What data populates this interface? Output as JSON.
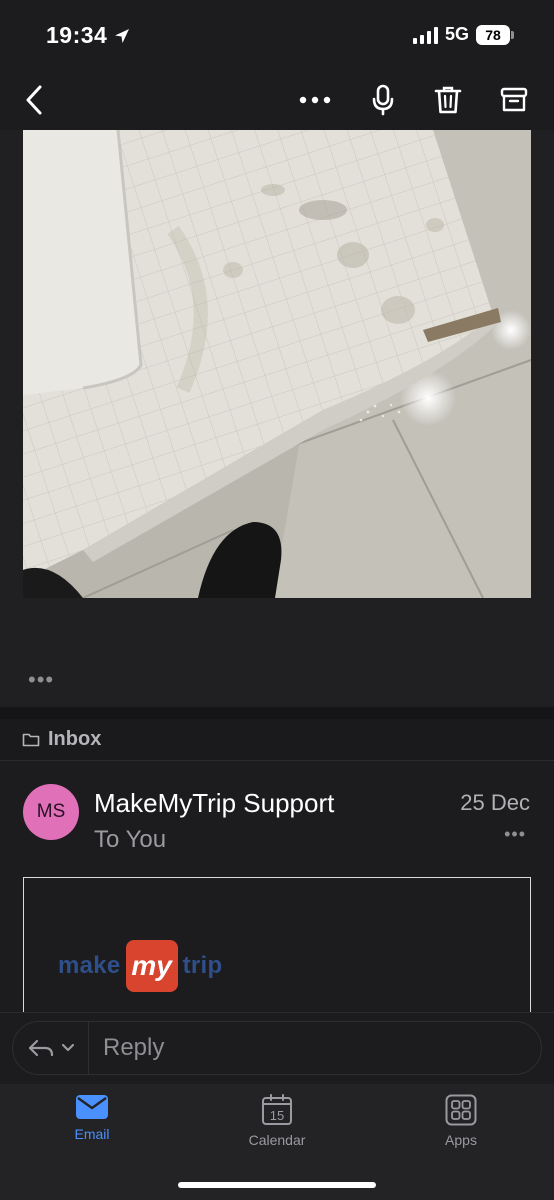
{
  "status_bar": {
    "time": "19:34",
    "network": "5G",
    "battery": "78"
  },
  "toolbar": {
    "back_icon": "chevron-left-icon",
    "more_icon": "ellipsis-icon",
    "mic_icon": "microphone-icon",
    "delete_icon": "trash-icon",
    "archive_icon": "archive-icon"
  },
  "message_body": {
    "more": "•••"
  },
  "folder": {
    "label": "Inbox"
  },
  "message": {
    "avatar_initials": "MS",
    "avatar_color": "#e070b8",
    "sender": "MakeMyTrip Support",
    "recipient": "To You",
    "date": "25 Dec",
    "more": "•••"
  },
  "quoted_logo": {
    "make": "make",
    "my": "my",
    "trip": "trip"
  },
  "reply": {
    "placeholder": "Reply"
  },
  "tabs": [
    {
      "label": "Email",
      "icon": "mail-icon",
      "active": true
    },
    {
      "label": "Calendar",
      "icon": "calendar-icon",
      "day": "15",
      "active": false
    },
    {
      "label": "Apps",
      "icon": "apps-grid-icon",
      "active": false
    }
  ],
  "colors": {
    "accent": "#4a90ff",
    "background": "#1c1c1e",
    "brand_red": "#d9442f",
    "brand_blue": "#2e4f8a"
  }
}
